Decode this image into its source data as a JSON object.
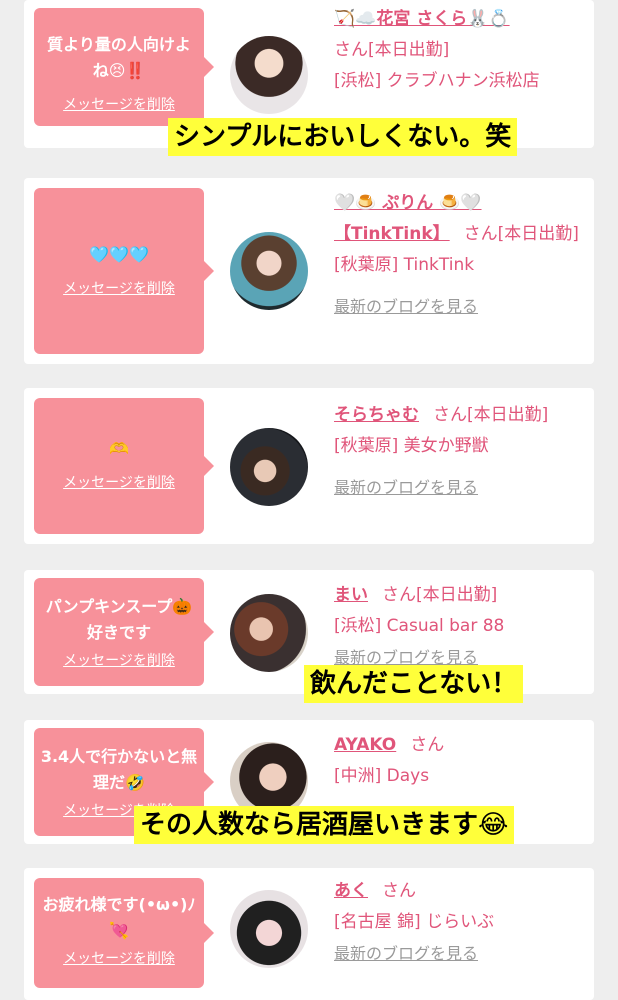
{
  "cards": [
    {
      "message": "質より量の人向けよね😣‼️",
      "delete_label": "メッセージを削除",
      "name": "🏹☁️花宮 さくら🐰💍",
      "san": "さん",
      "status": "[本日出勤]",
      "location": "[浜松] クラブハナン浜松店"
    },
    {
      "message": "🩵🩵🩵",
      "delete_label": "メッセージを削除",
      "name": "🤍🍮 ぷりん 🍮🤍【TinkTink】",
      "san": "さん",
      "status": "[本日出勤]",
      "location": "[秋葉原] TinkTink",
      "blog": "最新のブログを見る"
    },
    {
      "message": "🫶",
      "delete_label": "メッセージを削除",
      "name": "そらちゃむ",
      "san": "さん",
      "status": "[本日出勤]",
      "location": "[秋葉原] 美女か野獣",
      "blog": "最新のブログを見る"
    },
    {
      "message": "パンプキンスープ🎃好きです",
      "delete_label": "メッセージを削除",
      "name": "まい",
      "san": "さん",
      "status": "[本日出勤]",
      "location": "[浜松] Casual bar 88",
      "blog": "最新のブログを見る"
    },
    {
      "message": "3.4人で行かないと無理だ🤣",
      "delete_label": "メッセージを削除",
      "name": "AYAKO",
      "san": "さん",
      "location": "[中洲] Days"
    },
    {
      "message": "お疲れ様です(•ω•)ﾉ💘",
      "delete_label": "メッセージを削除",
      "name": "あく",
      "san": "さん",
      "location": "[名古屋 錦] じらいぶ",
      "blog": "最新のブログを見る"
    }
  ],
  "captions": [
    "シンプルにおいしくない。笑",
    "飲んだことない！",
    "その人数なら居酒屋いきます😂"
  ],
  "colors": {
    "pink": "#f7919a",
    "name": "#e0557a",
    "caption_bg": "#ffff3a"
  }
}
